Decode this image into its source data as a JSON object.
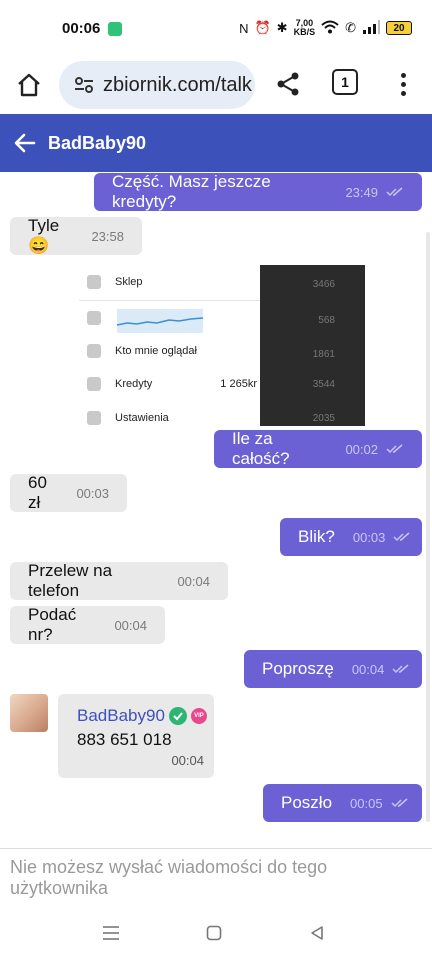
{
  "status_bar": {
    "time": "00:06",
    "network_speed_value": "7,00",
    "network_speed_unit": "KB/S",
    "battery": "20"
  },
  "browser": {
    "url": "zbiornik.com/talk",
    "tab_count": "1"
  },
  "header": {
    "title": "BadBaby90"
  },
  "messages": [
    {
      "dir": "out",
      "text": "Część. Masz jeszcze kredyty?",
      "time": "23:49"
    },
    {
      "dir": "in",
      "text": "Tyle😄",
      "time": "23:58"
    },
    {
      "dir": "out",
      "text": "Ile za całość?",
      "time": "00:02"
    },
    {
      "dir": "in",
      "text": "60 zł",
      "time": "00:03"
    },
    {
      "dir": "out",
      "text": "Blik?",
      "time": "00:03"
    },
    {
      "dir": "in",
      "text": "Przelew na telefon",
      "time": "00:04"
    },
    {
      "dir": "in",
      "text": "Podać nr?",
      "time": "00:04"
    },
    {
      "dir": "out",
      "text": "Poproszę",
      "time": "00:04"
    },
    {
      "dir": "out",
      "text": "Poszło",
      "time": "00:05"
    }
  ],
  "shared_screenshot": {
    "rows": [
      {
        "label": "Sklep",
        "value": "3466"
      },
      {
        "label": "",
        "value": "568"
      },
      {
        "label": "Kto mnie oglądał",
        "value": "1861"
      },
      {
        "label": "Kredyty",
        "amount": "1 265kr",
        "value": "3544"
      },
      {
        "label": "Ustawienia",
        "value": "2035"
      }
    ]
  },
  "contact_card": {
    "name": "BadBaby90",
    "badge": "VIP",
    "phone": "883 651 018",
    "time": "00:04"
  },
  "footer": {
    "notice": "Nie możesz wysłać wiadomości do tego użytkownika"
  },
  "icons": {
    "verified": "check-circle-icon",
    "read": "double-check-icon"
  },
  "colors": {
    "header": "#3d51ba",
    "outgoing": "#6b61d4",
    "incoming": "#e9e9e9"
  }
}
